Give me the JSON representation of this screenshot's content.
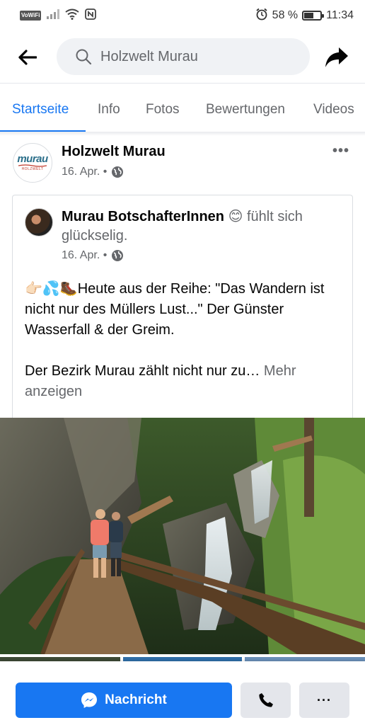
{
  "status_bar": {
    "carrier_badge": "VoWiFi",
    "battery": "58 %",
    "battery_level": 0.58,
    "time": "11:34",
    "icons": [
      "signal-icon",
      "wifi-icon",
      "nfc-icon",
      "alarm-icon",
      "battery-icon"
    ]
  },
  "header": {
    "search_value": "Holzwelt Murau",
    "icons": [
      "back-arrow-icon",
      "search-icon",
      "share-icon"
    ]
  },
  "tabs": [
    {
      "label": "Startseite",
      "active": true
    },
    {
      "label": "Info",
      "active": false
    },
    {
      "label": "Fotos",
      "active": false
    },
    {
      "label": "Bewertungen",
      "active": false
    },
    {
      "label": "Videos",
      "active": false
    }
  ],
  "post": {
    "page_name": "Holzwelt Murau",
    "date": "16. Apr. •",
    "logo_main": "murau",
    "logo_sub": "HOLZWELT",
    "shared": {
      "author": "Murau BotschafterInnen",
      "feeling": "😊 fühlt sich glückselig.",
      "date": "16. Apr. •",
      "text_1": "👉🏻💦🥾Heute aus der Reihe: \"Das Wandern ist nicht nur des Müllers Lust...\" Der Günster Wasserfall & der Greim.",
      "text_2": "Der Bezirk Murau zählt nicht nur zu…",
      "more_label": "Mehr anzeigen"
    }
  },
  "actions": {
    "message_label": "Nachricht",
    "more_label": "···"
  },
  "colors": {
    "accent": "#1877f2",
    "secondary_text": "#65676b",
    "button_gray": "#e4e6eb"
  }
}
